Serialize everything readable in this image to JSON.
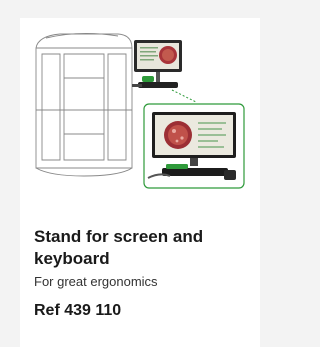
{
  "product": {
    "title": "Stand for screen and keyboard",
    "subtitle": "For great ergonomics",
    "ref": "Ref 439 110"
  },
  "colors": {
    "accent": "#2e9a3a",
    "text": "#1a1a1a",
    "background": "#f3f3f3",
    "card": "#ffffff"
  },
  "icons": {
    "illustration": "analyzer-with-screen-stand-illustration"
  }
}
